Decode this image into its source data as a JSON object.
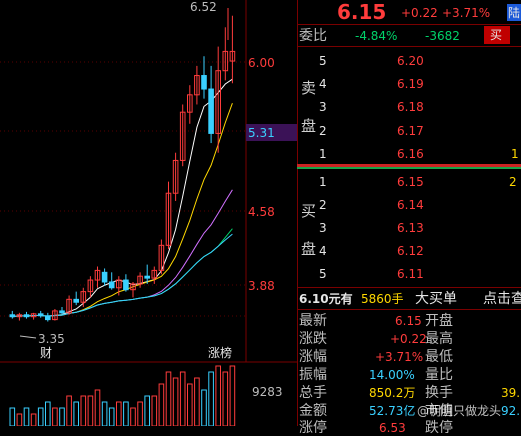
{
  "colors": {
    "up": "#ff3c3c",
    "down": "#00d26a",
    "bg": "#000000",
    "grid": "#5a0000",
    "price_tag": "#3b1257",
    "accent_cyan": "#3ad0ff",
    "mark_yellow": "#ffd800"
  },
  "chart": {
    "max_label": "6.52",
    "min_label": "3.35",
    "price_levels": [
      "6.00",
      "5.31",
      "4.58",
      "3.88"
    ],
    "current_price_tag": "5.31",
    "event_mark": "财",
    "limit_up_mark": "涨榜",
    "volume_label": "9283"
  },
  "chart_data": {
    "type": "candlestick",
    "ylim": [
      3.2,
      6.6
    ],
    "candles": [
      {
        "o": 3.42,
        "h": 3.46,
        "l": 3.38,
        "c": 3.4
      },
      {
        "o": 3.4,
        "h": 3.44,
        "l": 3.36,
        "c": 3.42
      },
      {
        "o": 3.42,
        "h": 3.45,
        "l": 3.38,
        "c": 3.4
      },
      {
        "o": 3.4,
        "h": 3.44,
        "l": 3.37,
        "c": 3.43
      },
      {
        "o": 3.43,
        "h": 3.46,
        "l": 3.39,
        "c": 3.41
      },
      {
        "o": 3.41,
        "h": 3.44,
        "l": 3.35,
        "c": 3.37
      },
      {
        "o": 3.37,
        "h": 3.48,
        "l": 3.36,
        "c": 3.46
      },
      {
        "o": 3.46,
        "h": 3.5,
        "l": 3.42,
        "c": 3.44
      },
      {
        "o": 3.44,
        "h": 3.62,
        "l": 3.42,
        "c": 3.58
      },
      {
        "o": 3.58,
        "h": 3.66,
        "l": 3.52,
        "c": 3.55
      },
      {
        "o": 3.55,
        "h": 3.7,
        "l": 3.5,
        "c": 3.66
      },
      {
        "o": 3.66,
        "h": 3.82,
        "l": 3.6,
        "c": 3.78
      },
      {
        "o": 3.78,
        "h": 3.92,
        "l": 3.7,
        "c": 3.88
      },
      {
        "o": 3.86,
        "h": 3.9,
        "l": 3.72,
        "c": 3.76
      },
      {
        "o": 3.76,
        "h": 3.86,
        "l": 3.68,
        "c": 3.7
      },
      {
        "o": 3.7,
        "h": 3.82,
        "l": 3.62,
        "c": 3.78
      },
      {
        "o": 3.78,
        "h": 3.84,
        "l": 3.66,
        "c": 3.68
      },
      {
        "o": 3.68,
        "h": 3.76,
        "l": 3.6,
        "c": 3.74
      },
      {
        "o": 3.74,
        "h": 3.86,
        "l": 3.7,
        "c": 3.82
      },
      {
        "o": 3.82,
        "h": 3.94,
        "l": 3.74,
        "c": 3.8
      },
      {
        "o": 3.8,
        "h": 3.92,
        "l": 3.74,
        "c": 3.88
      },
      {
        "o": 3.88,
        "h": 4.2,
        "l": 3.84,
        "c": 4.14
      },
      {
        "o": 4.14,
        "h": 4.8,
        "l": 4.1,
        "c": 4.68
      },
      {
        "o": 4.68,
        "h": 5.1,
        "l": 4.6,
        "c": 5.02
      },
      {
        "o": 5.02,
        "h": 5.6,
        "l": 4.96,
        "c": 5.52
      },
      {
        "o": 5.52,
        "h": 5.8,
        "l": 5.4,
        "c": 5.7
      },
      {
        "o": 5.7,
        "h": 6.0,
        "l": 5.6,
        "c": 5.9
      },
      {
        "o": 5.9,
        "h": 6.1,
        "l": 5.66,
        "c": 5.76
      },
      {
        "o": 5.76,
        "h": 6.0,
        "l": 5.2,
        "c": 5.3
      },
      {
        "o": 5.3,
        "h": 6.2,
        "l": 5.1,
        "c": 5.95
      },
      {
        "o": 5.95,
        "h": 6.4,
        "l": 5.85,
        "c": 6.15
      },
      {
        "o": 6.05,
        "h": 6.52,
        "l": 5.82,
        "c": 6.15
      }
    ],
    "volume": [
      3,
      2,
      3,
      2,
      3,
      4,
      3,
      3,
      5,
      4,
      5,
      5,
      6,
      4,
      3,
      4,
      4,
      3,
      4,
      5,
      5,
      7,
      9,
      8,
      9,
      7,
      8,
      6,
      9,
      10,
      9,
      10
    ]
  },
  "quote": {
    "price": "6.15",
    "change": "+0.22",
    "change_pct": "+3.71%",
    "exchange_badge": "陆",
    "weibi_label": "委比",
    "weibi_pct": "-4.84%",
    "weibi_diff": "-3682",
    "sell_btn": "买"
  },
  "order_book": {
    "sell_side_label": [
      "卖",
      "盘"
    ],
    "buy_side_label": [
      "买",
      "盘"
    ],
    "asks": [
      {
        "level": "5",
        "price": "6.20"
      },
      {
        "level": "4",
        "price": "6.19"
      },
      {
        "level": "3",
        "price": "6.18"
      },
      {
        "level": "2",
        "price": "6.17"
      },
      {
        "level": "1",
        "price": "6.16",
        "vol": "1"
      }
    ],
    "bids": [
      {
        "level": "1",
        "price": "6.15",
        "vol": "2"
      },
      {
        "level": "2",
        "price": "6.14"
      },
      {
        "level": "3",
        "price": "6.13"
      },
      {
        "level": "4",
        "price": "6.12"
      },
      {
        "level": "5",
        "price": "6.11"
      }
    ]
  },
  "trade_bar": {
    "price": "6.10元有",
    "volume": "5860手",
    "big_order": "大买单",
    "detail": "点击查"
  },
  "stats": [
    {
      "label": "最新",
      "value": "6.15",
      "label2": "开盘"
    },
    {
      "label": "涨跌",
      "value": "+0.22",
      "label2": "最高"
    },
    {
      "label": "涨幅",
      "value": "+3.71%",
      "label2": "最低"
    },
    {
      "label": "振幅",
      "value": "14.00%",
      "label2": "量比"
    },
    {
      "label": "总手",
      "value": "850.2万",
      "label2": "换手",
      "value2": "39."
    },
    {
      "label": "金额",
      "value": "52.73亿",
      "label2": "市值",
      "value2": "92."
    },
    {
      "label": "涨停",
      "value": "6.53",
      "label2": "跌停"
    }
  ],
  "watermark": "@明明只做龙头"
}
